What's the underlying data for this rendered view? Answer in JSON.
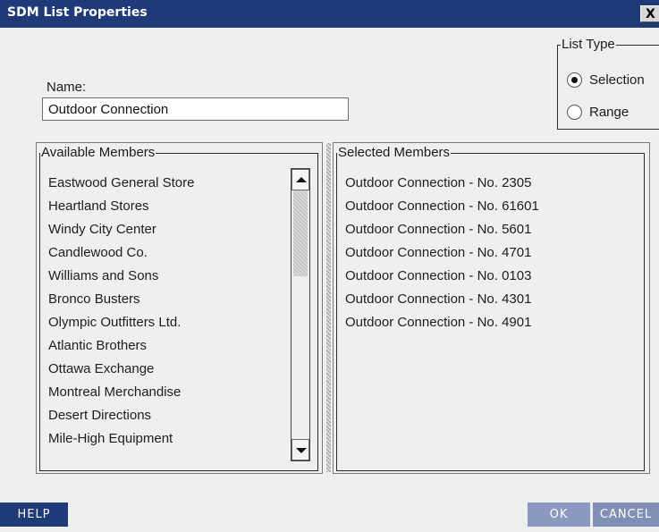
{
  "window": {
    "title": "SDM List Properties",
    "close_glyph": "X"
  },
  "name_field": {
    "label": "Name:",
    "value": "Outdoor Connection"
  },
  "list_type": {
    "title": "List Type",
    "options": [
      {
        "label": "Selection",
        "selected": true
      },
      {
        "label": "Range",
        "selected": false
      }
    ]
  },
  "available_members": {
    "title": "Available Members",
    "items": [
      "Eastwood General Store",
      "Heartland Stores",
      "Windy City Center",
      "Candlewood Co.",
      "Williams and Sons",
      "Bronco Busters",
      "Olympic Outfitters Ltd.",
      "Atlantic Brothers",
      "Ottawa Exchange",
      "Montreal Merchandise",
      "Desert Directions",
      "Mile-High Equipment"
    ]
  },
  "selected_members": {
    "title": "Selected Members",
    "items": [
      "Outdoor Connection - No. 2305",
      "Outdoor Connection - No. 61601",
      "Outdoor Connection - No. 5601",
      "Outdoor Connection - No. 4701",
      "Outdoor Connection - No. 0103",
      "Outdoor Connection - No. 4301",
      "Outdoor Connection - No. 4901"
    ]
  },
  "buttons": {
    "help": "HELP",
    "ok": "OK",
    "cancel": "CANCEL"
  },
  "colors": {
    "titlebar": "#1f3a78",
    "dialog_bg": "#eef0f0",
    "ok_button": "#8999bf",
    "cancel_button": "#7f8fb5"
  }
}
